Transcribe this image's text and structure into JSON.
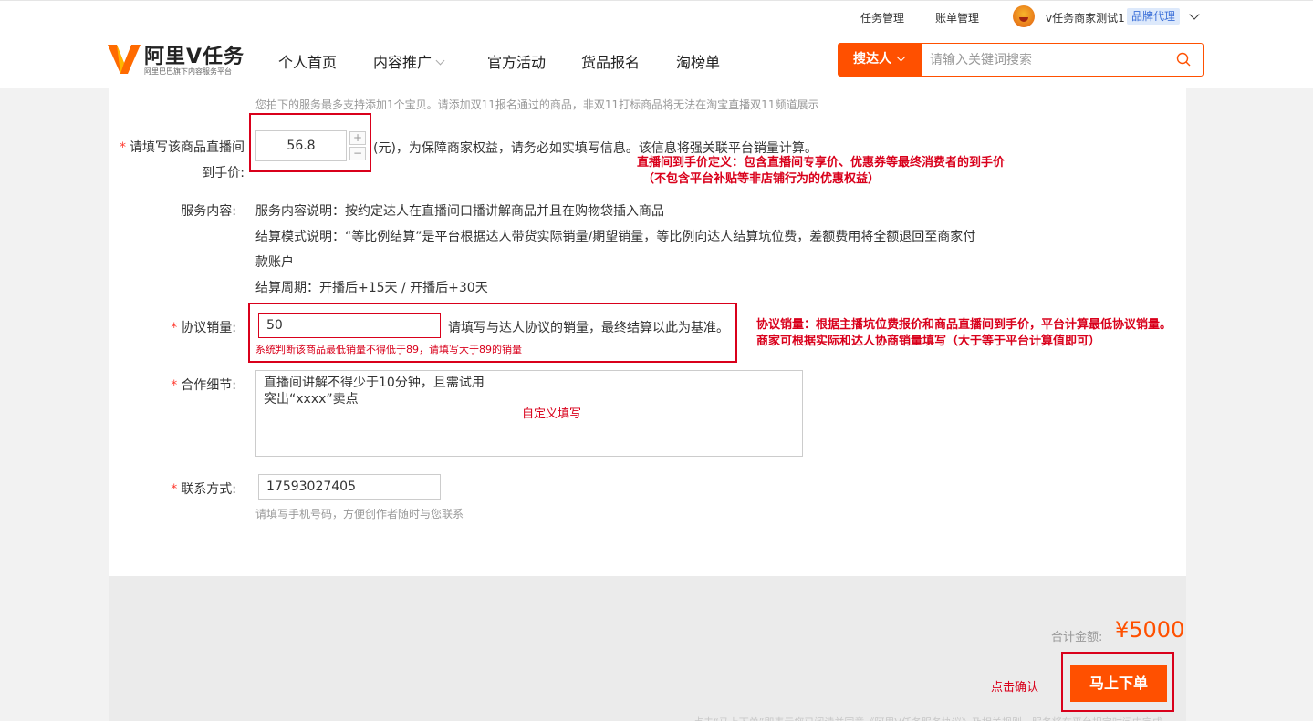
{
  "topbar": {
    "task_management": "任务管理",
    "bill_management": "账单管理",
    "user_name": "v任务商家测试1",
    "brand_badge": "品牌代理"
  },
  "logo": {
    "title": "阿里V任务",
    "subtitle": "阿里巴巴旗下内容服务平台"
  },
  "nav": {
    "items": [
      {
        "label": "个人首页"
      },
      {
        "label": "内容推广"
      },
      {
        "label": "官方活动"
      },
      {
        "label": "货品报名"
      },
      {
        "label": "淘榜单"
      }
    ]
  },
  "search": {
    "type_label": "搜达人",
    "placeholder": "请输入关键词搜索"
  },
  "form": {
    "tip": "您拍下的服务最多支持添加1个宝贝。请添加双11报名通过的商品，非双11打标商品将无法在淘宝直播双11频道展示",
    "price": {
      "label_line1": "请填写该商品直播间",
      "label_line2": "到手价:",
      "value": "56.8",
      "plus": "+",
      "minus": "−",
      "suffix": "(元)，为保障商家权益，请务必如实填写信息。该信息将强关联平台销量计算。",
      "annotation_line1": "直播间到手价定义：包含直播间专享价、优惠券等最终消费者的到手价",
      "annotation_line2": "（不包含平台补贴等非店铺行为的优惠权益）"
    },
    "service": {
      "label": "服务内容:",
      "line1": "服务内容说明：按约定达人在直播间口播讲解商品并且在购物袋插入商品",
      "line2": "结算模式说明：“等比例结算”是平台根据达人带货实际销量/期望销量，等比例向达人结算坑位费，差额费用将全额退回至商家付",
      "line3": "款账户",
      "line4": "结算周期：开播后+15天 / 开播后+30天"
    },
    "quantity": {
      "label": "协议销量:",
      "value": "50",
      "hint": "请填写与达人协议的销量，最终结算以此为基准。",
      "error": "系统判断该商品最低销量不得低于89，请填写大于89的销量",
      "annotation_line1": "协议销量：根据主播坑位费报价和商品直播间到手价，平台计算最低协议销量。",
      "annotation_line2": "商家可根据实际和达人协商销量填写（大于等于平台计算值即可）"
    },
    "detail": {
      "label": "合作细节:",
      "line1": "直播间讲解不得少于10分钟，且需试用",
      "line2": "突出“xxxx”卖点",
      "annotation": "自定义填写"
    },
    "contact": {
      "label": "联系方式:",
      "value": "17593027405",
      "hint": "请填写手机号码，方便创作者随时与您联系"
    }
  },
  "footer": {
    "total_label": "合计金额:",
    "total_amount": "¥5000",
    "confirm_annotation": "点击确认",
    "order_button": "马上下单",
    "faint_text": "点击“马上下单”即表示您已阅读并同意《阿里V任务服务协议》及相关规则，服务将在平台规定时间内完成"
  },
  "colors": {
    "accent": "#ff5000",
    "annotation_red": "#d9001b",
    "badge_bg": "#dde9fb",
    "badge_text": "#3b6fd8"
  }
}
